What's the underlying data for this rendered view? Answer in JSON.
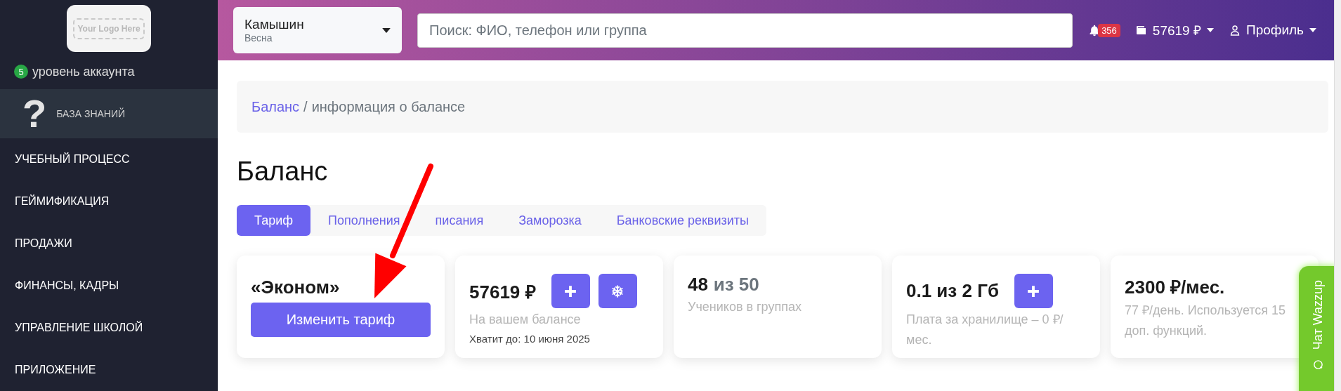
{
  "sidebar": {
    "logo": {
      "text": "Your Logo Here"
    },
    "account_level": {
      "badge": "5",
      "label": "уровень аккаунта"
    },
    "help": {
      "icon": "?",
      "label": "БАЗА ЗНАНИЙ",
      "selected": true
    },
    "items": [
      {
        "label": "УЧЕБНЫЙ ПРОЦЕСС",
        "selected": false
      },
      {
        "label": "ГЕЙМИФИКАЦИЯ",
        "selected": false
      },
      {
        "label": "ПРОДАЖИ",
        "selected": false
      },
      {
        "label": "ФИНАНСЫ, КАДРЫ",
        "selected": false
      },
      {
        "label": "УПРАВЛЕНИЕ ШКОЛОЙ",
        "selected": false
      },
      {
        "label": "ПРИЛОЖЕНИЕ",
        "selected": false
      }
    ]
  },
  "header": {
    "city": {
      "name": "Камышин",
      "season": "Весна"
    },
    "search": {
      "placeholder": "Поиск: ФИО, телефон или группа"
    },
    "notifications": {
      "count": "356"
    },
    "wallet": {
      "amount": "57619 ₽"
    },
    "profile": {
      "label": "Профиль"
    }
  },
  "breadcrumb": {
    "items": [
      {
        "label": "Баланс",
        "link": true
      },
      {
        "label": "информация о балансе",
        "link": false
      }
    ],
    "separator": "/"
  },
  "title": "Баланс",
  "tabs": [
    {
      "label": "Тариф",
      "selected": true
    },
    {
      "label": "Пополнения",
      "selected": false
    },
    {
      "label": "писания",
      "selected": false
    },
    {
      "label": "Заморозка",
      "selected": false
    },
    {
      "label": "Банковские реквизиты",
      "selected": false
    }
  ],
  "cards": [
    {
      "kind": "plan",
      "title": "«Эконом»",
      "button": "Изменить тариф"
    },
    {
      "kind": "stat",
      "title": "57619 ₽",
      "actions": [
        {
          "kind": "plus"
        },
        {
          "kind": "freeze"
        }
      ],
      "subtitle": "На вашем балансе",
      "note": "Хватит до: 10 июня 2025"
    },
    {
      "kind": "stat",
      "title": "48",
      "title_muted": "из 50",
      "subtitle": "Учеников в группах"
    },
    {
      "kind": "stat",
      "title": "0.1 из 2 Гб",
      "actions": [
        {
          "kind": "plus"
        }
      ],
      "subtitle": "Плата за хранилище – 0 ₽/мес."
    },
    {
      "kind": "stat",
      "title": "2300 ₽/мес.",
      "subtitle": "77 ₽/день. Используется 15 доп. функций."
    }
  ],
  "chat": {
    "label": "Чат Wazzup"
  }
}
